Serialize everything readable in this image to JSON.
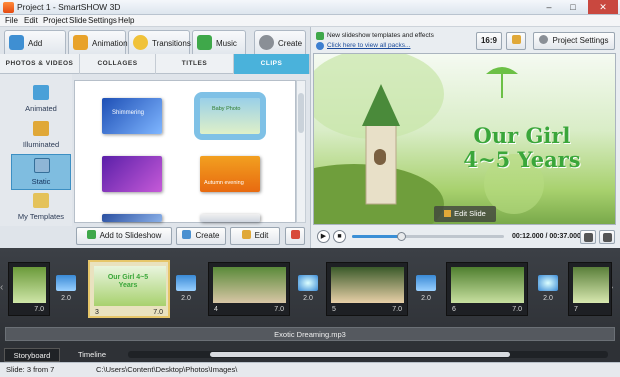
{
  "window": {
    "title": "Project 1 - SmartSHOW 3D",
    "min": "–",
    "max": "□",
    "close": "✕"
  },
  "menu": [
    "File",
    "Edit",
    "Project",
    "Slide",
    "Settings",
    "Help"
  ],
  "main_tabs": [
    {
      "label": "Add",
      "icon": "add-icon",
      "color": "#3f8fd2"
    },
    {
      "label": "Animation",
      "icon": "animation-icon",
      "color": "#e8a22a"
    },
    {
      "label": "Transitions",
      "icon": "transitions-icon",
      "color": "#f0c23a"
    },
    {
      "label": "Music",
      "icon": "music-icon",
      "color": "#3fa84a"
    },
    {
      "label": "Create",
      "icon": "create-icon",
      "color": "#8a8f96"
    }
  ],
  "sub_tabs": [
    "PHOTOS & VIDEOS",
    "COLLAGES",
    "TITLES",
    "CLIPS"
  ],
  "categories": [
    {
      "label": "Animated",
      "color": "#4aa0d8"
    },
    {
      "label": "Illuminated",
      "color": "#e0a838"
    },
    {
      "label": "Static",
      "color": "#8fb6d6"
    },
    {
      "label": "My Templates",
      "color": "#e4c25a"
    }
  ],
  "clip_thumbs": [
    {
      "name": "clip-blue-sparkle",
      "colors": [
        "#1e4fb5",
        "#7fb6ff"
      ],
      "caption": "Shimmering"
    },
    {
      "name": "clip-green-kids",
      "colors": [
        "#9ad0e8",
        "#dff0c8"
      ],
      "caption": "Baby Photo"
    },
    {
      "name": "clip-purple-stars",
      "colors": [
        "#5a1fa8",
        "#c65ad8"
      ],
      "caption": ""
    },
    {
      "name": "clip-orange-sunset",
      "colors": [
        "#f2a020",
        "#e86a10"
      ],
      "caption": "Autumn evening"
    },
    {
      "name": "clip-partial-1",
      "colors": [
        "#2a4fa0",
        "#8ab0e8"
      ],
      "caption": ""
    },
    {
      "name": "clip-partial-2",
      "colors": [
        "#f0f0f0",
        "#d0d6e0"
      ],
      "caption": ""
    }
  ],
  "actions": {
    "add_to_slideshow": "Add to Slideshow",
    "create": "Create",
    "edit": "Edit"
  },
  "ribbon": {
    "news_line1": "New slideshow templates and effects",
    "news_line2": "Click here to view all packs...",
    "aspect": "16:9",
    "project_settings": "Project Settings"
  },
  "preview": {
    "title_line1": "Our Girl",
    "title_line2": "4~5 Years",
    "edit_slide": "Edit Slide",
    "time_current": "00:12.000",
    "time_sep": "/",
    "time_total": "00:37.000",
    "progress": 0.32
  },
  "slides": [
    {
      "num": "",
      "dur": "7.0",
      "colors": [
        "#6b9a3a",
        "#cfe6a8"
      ]
    },
    {
      "num": "3",
      "dur": "7.0",
      "colors": [
        "#e9f5df",
        "#a8d16e"
      ],
      "title": "Our Girl 4~5 Years"
    },
    {
      "num": "4",
      "dur": "7.0",
      "colors": [
        "#5a8a3a",
        "#d8c6a6"
      ]
    },
    {
      "num": "5",
      "dur": "7.0",
      "colors": [
        "#3a5a2a",
        "#e8d0a8"
      ]
    },
    {
      "num": "6",
      "dur": "7.0",
      "colors": [
        "#4f7f2f",
        "#c8e0a0"
      ]
    },
    {
      "num": "7",
      "dur": "",
      "colors": [
        "#5a7f3a",
        "#d8e8b0"
      ]
    }
  ],
  "transitions": [
    "2.0",
    "2.0",
    "2.0",
    "2.0",
    "2.0",
    "2.0"
  ],
  "audio": "Exotic Dreaming.mp3",
  "bottom_tabs": [
    "Storyboard",
    "Timeline"
  ],
  "status": {
    "slide": "Slide: 3 from 7",
    "path": "C:\\Users\\Content\\Desktop\\Photos\\Images\\"
  }
}
